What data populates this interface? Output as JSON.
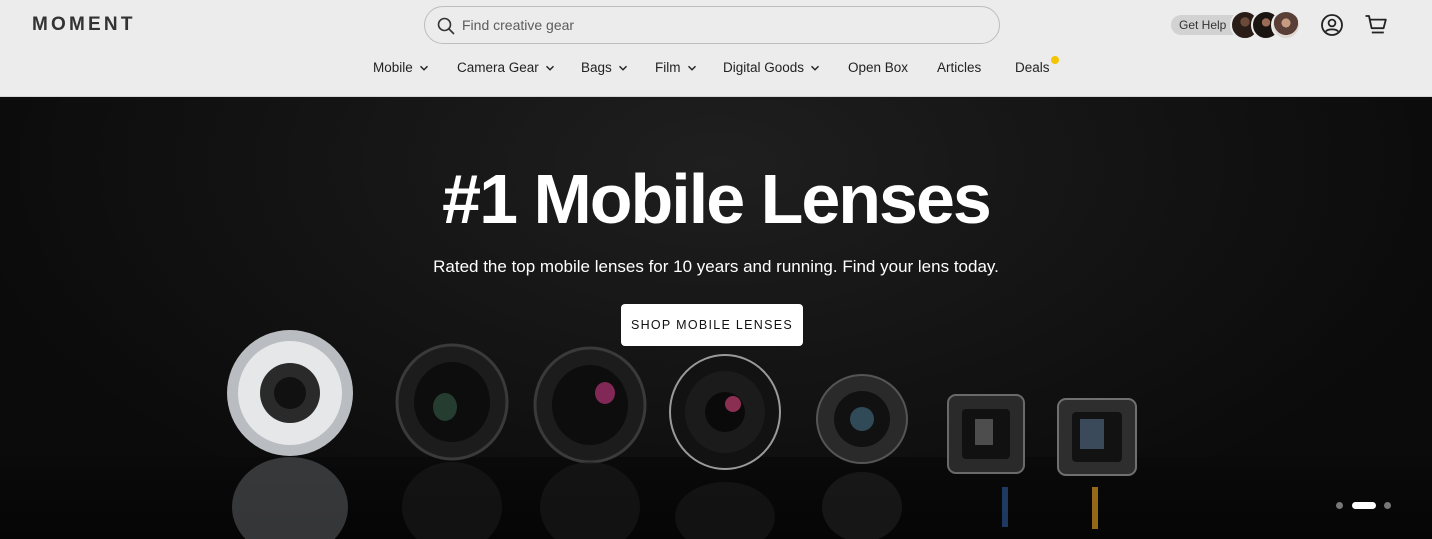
{
  "header": {
    "logo": "MOMENT",
    "search": {
      "placeholder": "Find creative gear",
      "value": ""
    },
    "help_label": "Get Help"
  },
  "nav": {
    "items": [
      {
        "label": "Mobile",
        "has_menu": true
      },
      {
        "label": "Camera Gear",
        "has_menu": true
      },
      {
        "label": "Bags",
        "has_menu": true
      },
      {
        "label": "Film",
        "has_menu": true
      },
      {
        "label": "Digital Goods",
        "has_menu": true
      },
      {
        "label": "Open Box",
        "has_menu": false
      },
      {
        "label": "Articles",
        "has_menu": false
      },
      {
        "label": "Deals",
        "has_menu": false
      }
    ]
  },
  "hero": {
    "title": "#1 Mobile Lenses",
    "subtitle": "Rated the top mobile lenses for 10 years and running. Find your lens today.",
    "cta": "SHOP MOBILE LENSES",
    "carousel": {
      "slides": 3,
      "active": 2
    }
  },
  "colors": {
    "header_bg": "#ececec",
    "deals_dot": "#f2c500",
    "hero_bg": "#111111",
    "cta_bg": "#ffffff"
  },
  "icons": [
    "search-icon",
    "account-icon",
    "cart-icon",
    "chevron-down-icon"
  ]
}
